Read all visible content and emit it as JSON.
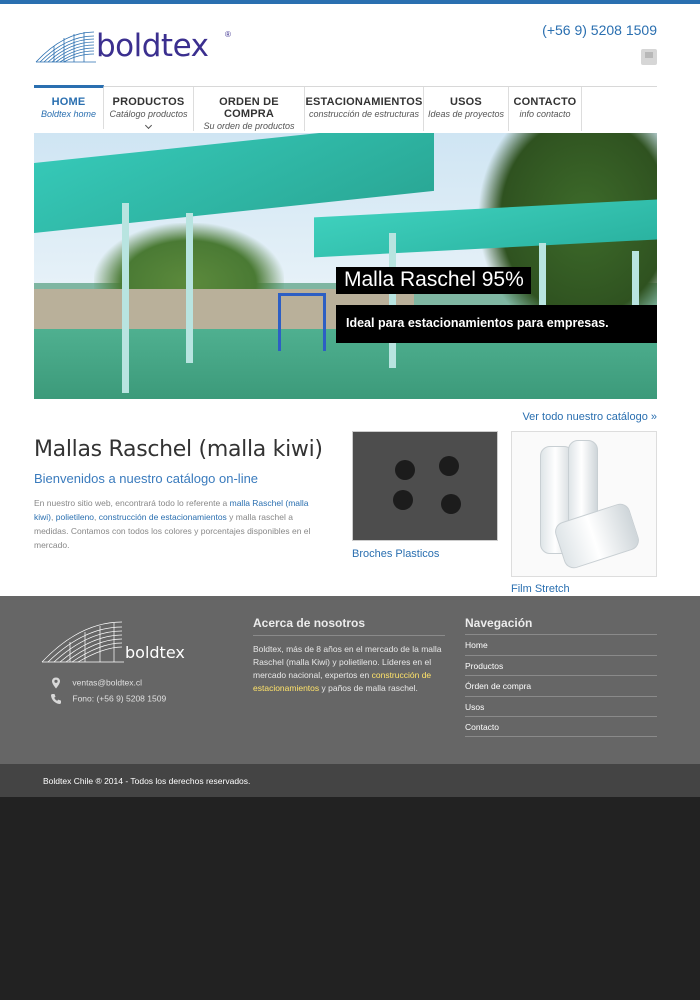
{
  "header": {
    "phone": "(+56 9) 5208 1509",
    "logo_text": "boldtex",
    "logo_mark": "®"
  },
  "nav": [
    {
      "label": "HOME",
      "sub": "Boldtex home",
      "active": true
    },
    {
      "label": "PRODUCTOS",
      "sub": "Catálogo productos"
    },
    {
      "label": "ORDEN DE COMPRA",
      "sub": "Su orden de productos"
    },
    {
      "label": "ESTACIONAMIENTOS",
      "sub": "construcción de estructuras"
    },
    {
      "label": "USOS",
      "sub": "Ideas de proyectos"
    },
    {
      "label": "CONTACTO",
      "sub": "info contacto"
    }
  ],
  "slider": {
    "title": "Malla Raschel 95%",
    "subtitle": "Ideal para estacionamientos para empresas."
  },
  "content": {
    "catalog_link": "Ver todo nuestro catálogo »",
    "title": "Mallas Raschel (malla kiwi)",
    "subtitle": "Bienvenidos a nuestro catálogo on-line",
    "intro_1": "En nuestro sitio web, encontrará todo lo referente a ",
    "link_1": "malla Raschel (malla kiwi)",
    "intro_2": ",",
    "link_2": "polietileno",
    "intro_3": ", ",
    "link_3": "construcción de estacionamientos",
    "intro_4": " y malla raschel a medidas. Contamos con todos los colores y porcentajes disponibles en el mercado.",
    "products": [
      {
        "label": "Broches Plasticos"
      },
      {
        "label": "Film Stretch"
      }
    ]
  },
  "footer": {
    "logo_text": "boldtex",
    "email": "ventas@boldtex.cl",
    "phone": "Fono: (+56 9) 5208 1509",
    "about_title": "Acerca de nosotros",
    "about_1": "Boldtex, más de 8 años en el mercado de la malla Raschel (malla Kiwi) y polietileno. Líderes en el mercado nacional, expertos en ",
    "about_link": "construcción de estacionamientos",
    "about_2": " y paños de malla raschel.",
    "nav_title": "Navegación",
    "nav_items": [
      "Home",
      "Productos",
      "Órden de compra",
      "Usos",
      "Contacto"
    ],
    "copyright": "Boldtex Chile ® 2014 - Todos los derechos reservados."
  },
  "colors": {
    "accent": "#2a6fb0",
    "logo": "#3b2f8f",
    "footer_bg": "#666666",
    "bottom_bg": "#444444",
    "page_bg": "#222222"
  }
}
